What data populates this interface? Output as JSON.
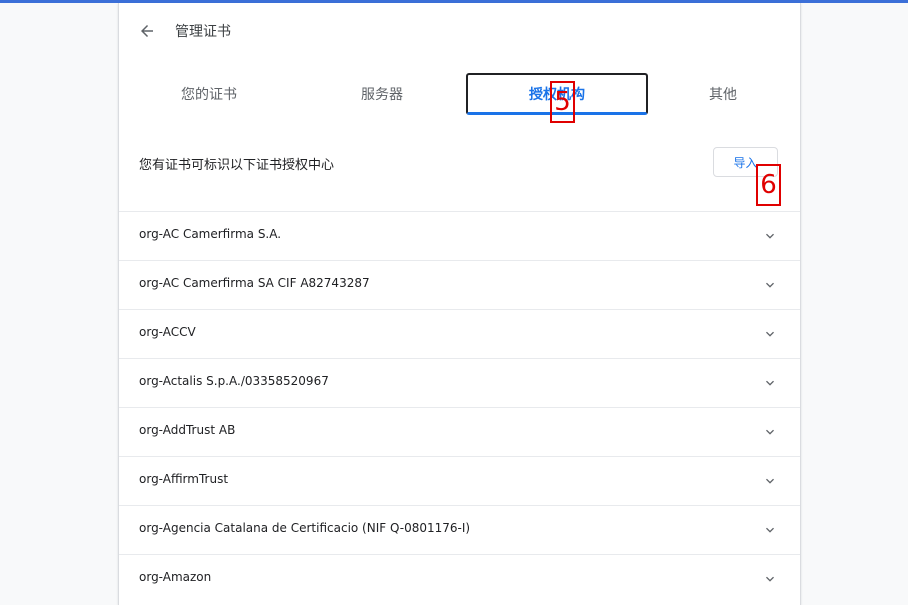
{
  "header": {
    "title": "管理证书"
  },
  "tabs": [
    {
      "label": "您的证书"
    },
    {
      "label": "服务器"
    },
    {
      "label": "授权机构"
    },
    {
      "label": "其他"
    }
  ],
  "active_tab": "授权机构",
  "authorities": {
    "description": "您有证书可标识以下证书授权中心",
    "import_label": "导入",
    "items": [
      {
        "name": "org-AC Camerfirma S.A."
      },
      {
        "name": "org-AC Camerfirma SA CIF A82743287"
      },
      {
        "name": "org-ACCV"
      },
      {
        "name": "org-Actalis S.p.A./03358520967"
      },
      {
        "name": "org-AddTrust AB"
      },
      {
        "name": "org-AffirmTrust"
      },
      {
        "name": "org-Agencia Catalana de Certificacio (NIF Q-0801176-I)"
      },
      {
        "name": "org-Amazon"
      }
    ]
  },
  "markers": [
    {
      "label": "5"
    },
    {
      "label": "6"
    }
  ],
  "colors": {
    "accent": "#1a73e8",
    "top_bar": "#3b6fd8",
    "marker": "#e00000"
  },
  "icons": {
    "back": "arrow-left-icon",
    "expand": "chevron-down-icon"
  }
}
